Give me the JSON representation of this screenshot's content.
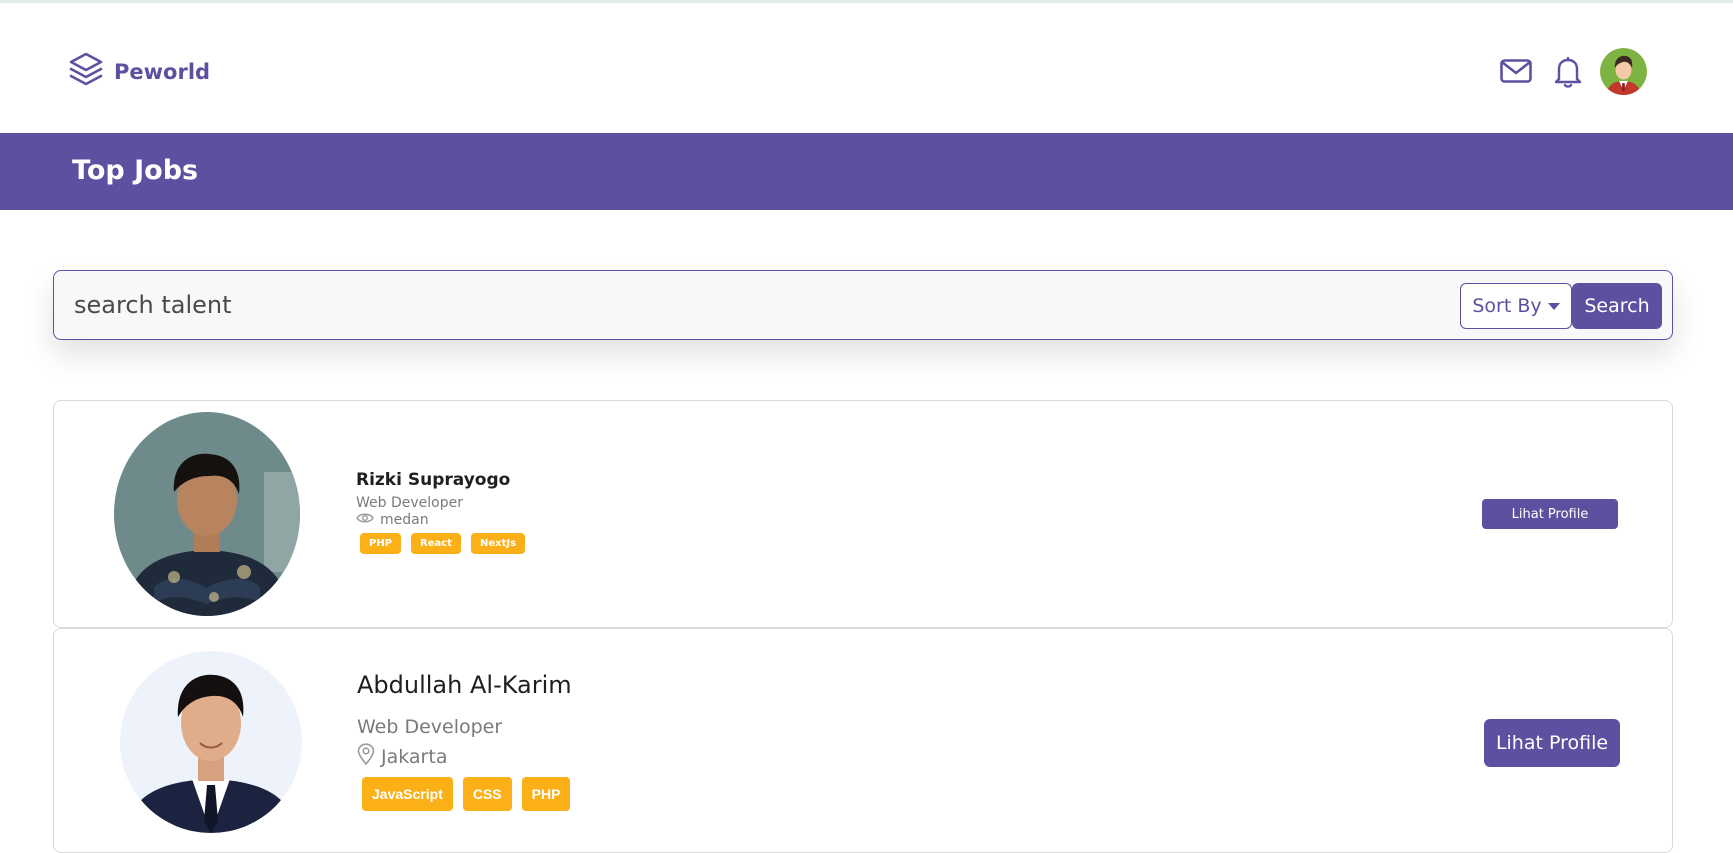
{
  "brand": {
    "name": "Peworld",
    "icon": "layers-icon"
  },
  "nav": {
    "icons": [
      "mail-icon",
      "bell-icon",
      "user-avatar"
    ]
  },
  "banner": {
    "title": "Top Jobs"
  },
  "search": {
    "placeholder": "search talent",
    "sort_label": "Sort By",
    "button_label": "Search"
  },
  "talents": [
    {
      "name": "Rizki Suprayogo",
      "role": "Web Developer",
      "location": "medan",
      "location_icon": "eye-icon",
      "skills": [
        "PHP",
        "React",
        "NextJs"
      ],
      "button": "Lihat Profile"
    },
    {
      "name": "Abdullah Al-Karim",
      "role": "Web Developer",
      "location": "Jakarta",
      "location_icon": "map-pin-icon",
      "skills": [
        "JavaScript",
        "CSS",
        "PHP"
      ],
      "button": "Lihat Profile"
    }
  ],
  "colors": {
    "primary": "#5e50a1",
    "skill": "#fbb017",
    "banner": "#5e50a1"
  }
}
